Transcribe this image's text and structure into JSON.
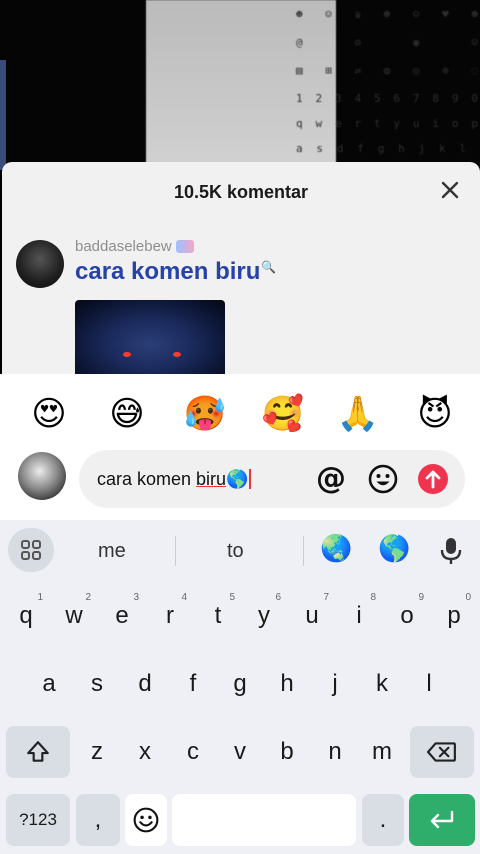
{
  "background": {
    "rows": [
      [
        "☻",
        "☺",
        "♛",
        "☻",
        "☺",
        "♥",
        "☻"
      ],
      [
        "@",
        "⊙",
        "◉",
        "☺"
      ],
      [
        "▤",
        "⊞",
        "⇌",
        "◍",
        "◎",
        "⊕",
        "◌"
      ],
      [
        "1",
        "2",
        "3",
        "4",
        "5",
        "6",
        "7",
        "8",
        "9",
        "0"
      ],
      [
        "q",
        "w",
        "e",
        "r",
        "t",
        "y",
        "u",
        "i",
        "o",
        "p"
      ],
      [
        "a",
        "s",
        "d",
        "f",
        "g",
        "h",
        "j",
        "k",
        "l"
      ]
    ]
  },
  "sheet": {
    "title": "10.5K komentar",
    "close_label": "Close"
  },
  "comment": {
    "username": "baddaselebew",
    "text": "cara komen biru",
    "text_suffix": "🔍"
  },
  "emoji_bar": [
    "😍",
    "😅",
    "🥵",
    "🥰",
    "🙏",
    "😈"
  ],
  "input": {
    "text_before": "cara komen ",
    "text_underlined": "biru",
    "text_emoji": "🌎",
    "at_label": "@"
  },
  "keyboard": {
    "suggestions": [
      "me",
      "to"
    ],
    "suggestion_emojis": [
      "🌏",
      "🌎"
    ],
    "row1": [
      {
        "k": "q",
        "h": "1"
      },
      {
        "k": "w",
        "h": "2"
      },
      {
        "k": "e",
        "h": "3"
      },
      {
        "k": "r",
        "h": "4"
      },
      {
        "k": "t",
        "h": "5"
      },
      {
        "k": "y",
        "h": "6"
      },
      {
        "k": "u",
        "h": "7"
      },
      {
        "k": "i",
        "h": "8"
      },
      {
        "k": "o",
        "h": "9"
      },
      {
        "k": "p",
        "h": "0"
      }
    ],
    "row2": [
      "a",
      "s",
      "d",
      "f",
      "g",
      "h",
      "j",
      "k",
      "l"
    ],
    "row3": [
      "z",
      "x",
      "c",
      "v",
      "b",
      "n",
      "m"
    ],
    "numbers_label": "?123",
    "comma_label": ",",
    "period_label": "."
  },
  "colors": {
    "accent_blue": "#2742a8",
    "send_red": "#f0344f",
    "enter_green": "#2eae6a"
  }
}
